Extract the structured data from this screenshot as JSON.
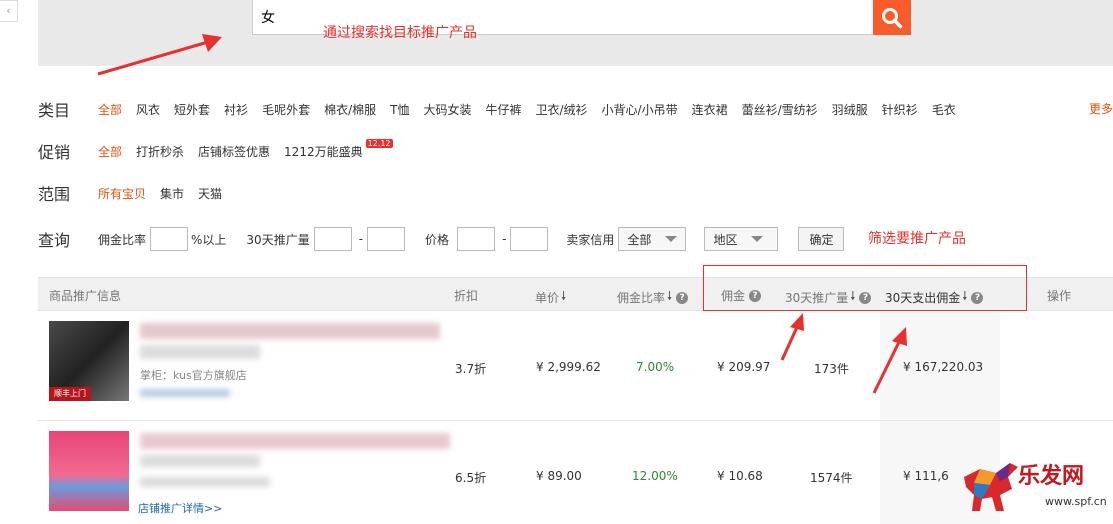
{
  "search": {
    "query": "女"
  },
  "annotations": {
    "search_note": "通过搜索找目标推广产品",
    "filter_note": "筛选要推广产品"
  },
  "category": {
    "title": "类目",
    "items": [
      "全部",
      "风衣",
      "短外套",
      "衬衫",
      "毛呢外套",
      "棉衣/棉服",
      "T恤",
      "大码女装",
      "牛仔裤",
      "卫衣/绒衫",
      "小背心/小吊带",
      "连衣裙",
      "蕾丝衫/雪纺衫",
      "羽绒服",
      "针织衫",
      "毛衣"
    ],
    "more": "更多"
  },
  "promo": {
    "title": "促销",
    "items": [
      "全部",
      "打折秒杀",
      "店铺标签优惠",
      "1212万能盛典"
    ],
    "badge": "12.12"
  },
  "scope": {
    "title": "范围",
    "items": [
      "所有宝贝",
      "集市",
      "天猫"
    ]
  },
  "query": {
    "title": "查询",
    "commission_label": "佣金比率",
    "commission_suffix": "%以上",
    "sales_label": "30天推广量",
    "price_label": "价格",
    "dash": "-",
    "credit_label": "卖家信用",
    "credit_value": "全部",
    "region_value": "地区",
    "confirm": "确定"
  },
  "table": {
    "headers": {
      "info": "商品推广信息",
      "discount": "折扣",
      "price": "单价",
      "rate": "佣金比率",
      "commission": "佣金",
      "sales30": "30天推广量",
      "payout30": "30天支出佣金",
      "action": "操作"
    },
    "rows": [
      {
        "thumb_tag": "顺丰上门",
        "shop": "掌柜：kus官方旗舰店",
        "discount": "3.7折",
        "price": "¥ 2,999.62",
        "rate": "7.00%",
        "commission": "¥ 209.97",
        "sales": "173件",
        "payout": "¥ 167,220.03"
      },
      {
        "thumb_tag": "",
        "shop": "",
        "link": "店铺推广详情>>",
        "discount": "6.5折",
        "price": "¥ 89.00",
        "rate": "12.00%",
        "commission": "¥ 10.68",
        "sales": "1574件",
        "payout": "¥ 111,6"
      }
    ]
  },
  "watermark": {
    "brand": "乐发网",
    "url": "www.spf.cn"
  },
  "colors": {
    "accent": "#e8500d",
    "search_button": "#f85c2a",
    "annotation": "#e8302c",
    "rate_green": "#2e8b2e"
  }
}
